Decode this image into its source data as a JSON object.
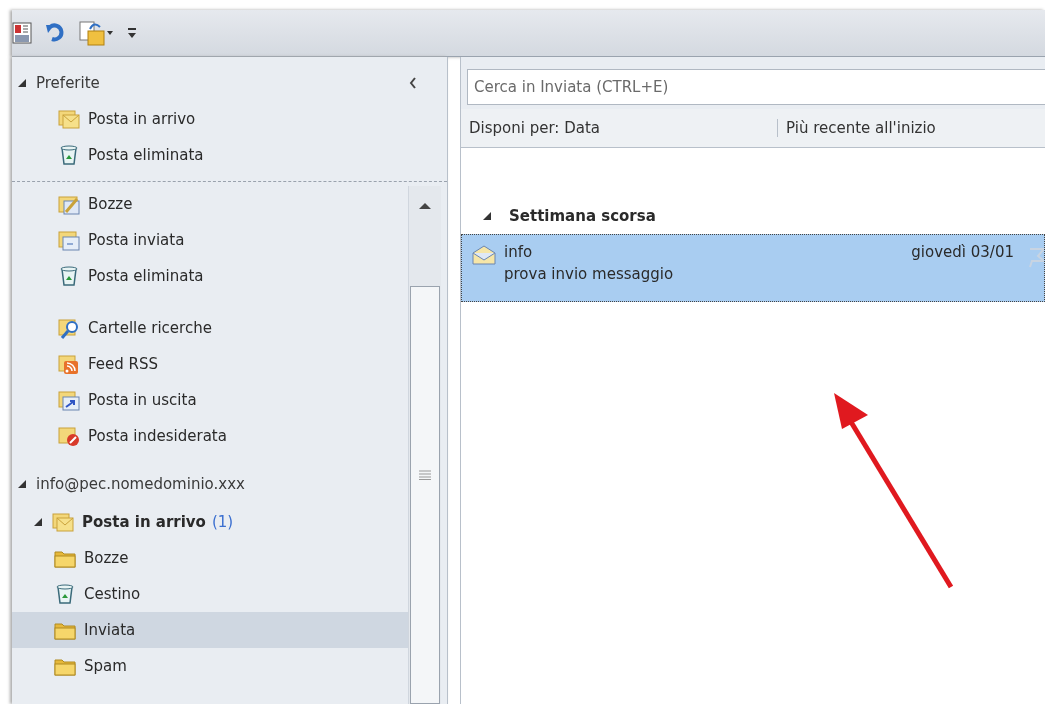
{
  "favorites": {
    "label": "Preferite",
    "expanded": true,
    "items": [
      {
        "label": "Posta in arrivo",
        "kind": "inbox",
        "selected": false
      },
      {
        "label": "Posta eliminata",
        "kind": "trash",
        "selected": false
      }
    ]
  },
  "folders": [
    {
      "label": "Bozze",
      "kind": "drafts",
      "selected": false
    },
    {
      "label": "Posta inviata",
      "kind": "sent",
      "selected": false
    },
    {
      "label": "Posta eliminata",
      "kind": "trash",
      "selected": false
    },
    {
      "label": "Cartelle ricerche",
      "kind": "search",
      "selected": false
    },
    {
      "label": "Feed RSS",
      "kind": "rss",
      "selected": false
    },
    {
      "label": "Posta in uscita",
      "kind": "outbox",
      "selected": false
    },
    {
      "label": "Posta indesiderata",
      "kind": "junk",
      "selected": false
    }
  ],
  "account": {
    "label": "info@pec.nomedominio.xxx",
    "expanded": true,
    "folders": [
      {
        "label": "Posta in arrivo",
        "count": "(1)",
        "kind": "inbox",
        "selected": false,
        "expanded": true,
        "children": [
          {
            "label": "Bozze",
            "kind": "folder",
            "selected": false
          },
          {
            "label": "Cestino",
            "kind": "trash",
            "selected": false
          },
          {
            "label": "Inviata",
            "kind": "folder",
            "selected": true
          },
          {
            "label": "Spam",
            "kind": "folder",
            "selected": false
          }
        ]
      }
    ]
  },
  "search": {
    "placeholder": "Cerca in Inviata (CTRL+E)"
  },
  "sort": {
    "arrange": "Disponi per: Data",
    "order": "Più recente all'inizio"
  },
  "groups": [
    {
      "label": "Settimana scorsa",
      "expanded": true,
      "messages": [
        {
          "sender": "info",
          "subject": "prova invio messaggio",
          "date": "giovedì 03/01",
          "selected": true
        }
      ]
    }
  ]
}
